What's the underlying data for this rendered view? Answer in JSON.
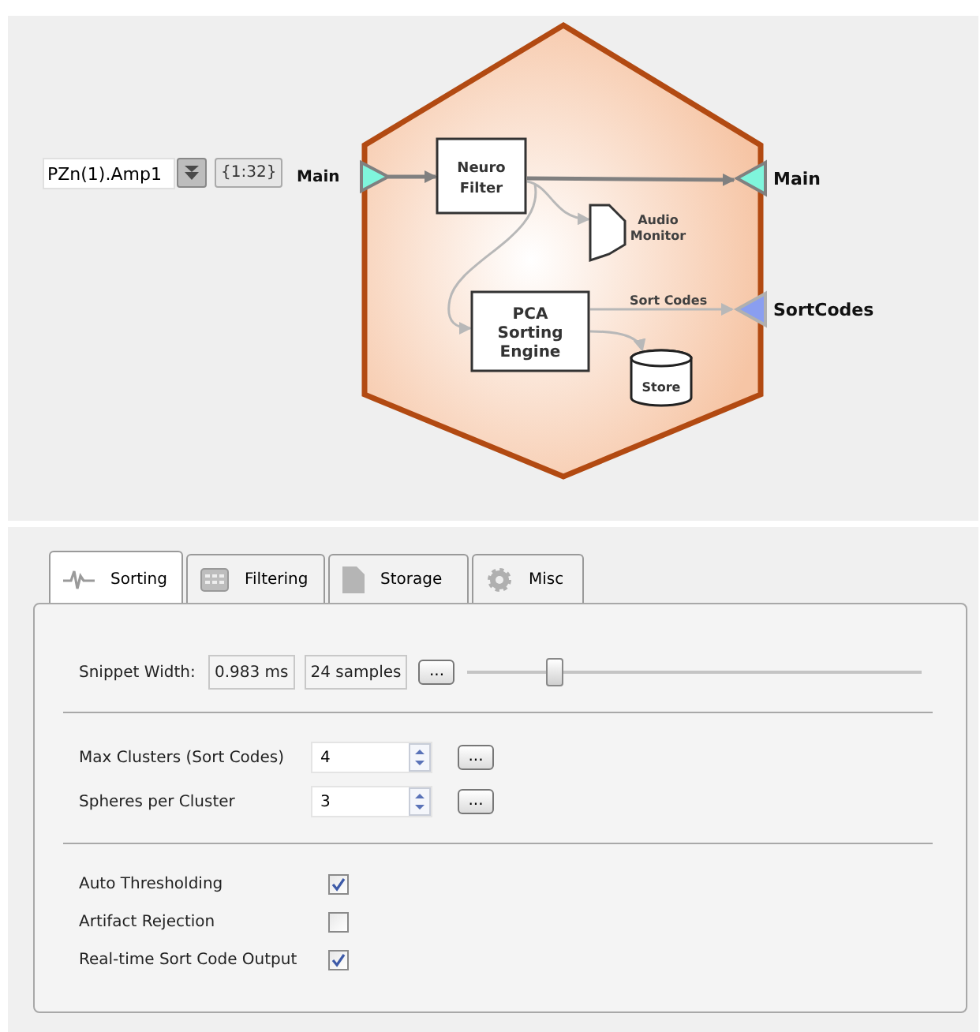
{
  "diagram": {
    "source_field": {
      "value": "PZn(1).Amp1"
    },
    "channel_button": "{1:32}",
    "input_ports": [
      {
        "label": "Main",
        "color": "#7ff5dc"
      }
    ],
    "output_ports": [
      {
        "label": "Main",
        "color": "#7ff5dc"
      },
      {
        "label": "SortCodes",
        "color": "#8a9ef0"
      }
    ],
    "blocks": [
      {
        "kind": "box",
        "label": "Neuro Filter"
      },
      {
        "kind": "speaker",
        "label": "Audio Monitor"
      },
      {
        "kind": "box",
        "label": "PCA Sorting Engine"
      },
      {
        "kind": "cylinder",
        "label": "Store"
      }
    ],
    "edge_label": "Sort Codes"
  },
  "tabs": [
    {
      "label": "Sorting",
      "selected": true
    },
    {
      "label": "Filtering",
      "selected": false
    },
    {
      "label": "Storage",
      "selected": false
    },
    {
      "label": "Misc",
      "selected": false
    }
  ],
  "snippet": {
    "label": "Snippet Width:",
    "time": "0.983 ms",
    "samples": "24 samples",
    "button": "...",
    "level": 0.18
  },
  "spin_rows": [
    {
      "label": "Max Clusters (Sort Codes)",
      "value": "4",
      "button": "..."
    },
    {
      "label": "Spheres per Cluster",
      "value": "3",
      "button": "..."
    }
  ],
  "checks": [
    {
      "label": "Auto Thresholding",
      "checked": true
    },
    {
      "label": "Artifact Rejection",
      "checked": false
    },
    {
      "label": "Real-time Sort Code Output",
      "checked": true
    }
  ]
}
